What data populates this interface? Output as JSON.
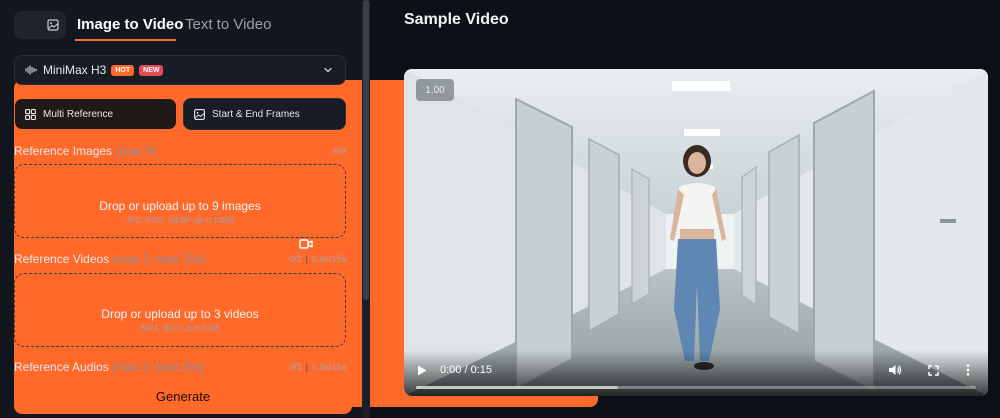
{
  "tabs": {
    "active": "Image to Video",
    "inactive": "Text to Video"
  },
  "model": {
    "name": "MiniMax H3",
    "badges": [
      "HOT",
      "NEW"
    ]
  },
  "reference_modes": {
    "multi": "Multi Reference",
    "frames": "Start & End Frames"
  },
  "sections": {
    "images": {
      "label": "Reference Images",
      "hint": "(max 9)",
      "count": "0/9",
      "drop_title": "Drop or upload up to 9 images",
      "drop_sub": "JPG, PNG, WEBP up to 10MB"
    },
    "videos": {
      "label": "Reference Videos",
      "hint": "(max 3, total 15s)",
      "count": "0/3",
      "duration": "0.0s/15s",
      "drop_title": "Drop or upload up to 3 videos",
      "drop_sub": "MP4, MOV up to 50M"
    },
    "audios": {
      "label": "Reference Audios",
      "hint": "(max 3, total 15s)",
      "count": "0/3",
      "duration": "0.0s/15s"
    }
  },
  "generate_label": "Generate",
  "preview": {
    "title": "Sample Video",
    "speed": "1.00",
    "time": "0:00 / 0:15",
    "progress": 0.36
  },
  "colors": {
    "accent": "#ff6a2b",
    "background": "#0d1117",
    "panel": "#12161d"
  },
  "icons": [
    "video-camera-icon",
    "image-icon",
    "waveform-icon",
    "chevron-down-icon",
    "grid-icon",
    "frame-image-icon",
    "upload-image-icon",
    "upload-video-icon",
    "play-icon",
    "volume-icon",
    "fullscreen-icon",
    "more-vertical-icon"
  ]
}
